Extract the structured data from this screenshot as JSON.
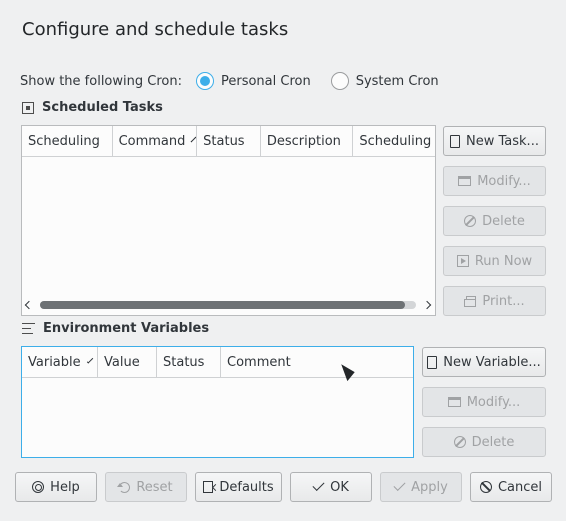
{
  "title": "Configure and schedule tasks",
  "cron_selector": {
    "label": "Show the following Cron:",
    "options": [
      {
        "label": "Personal Cron",
        "checked": true
      },
      {
        "label": "System Cron",
        "checked": false
      }
    ]
  },
  "scheduled_tasks": {
    "heading": "Scheduled Tasks",
    "columns": [
      "Scheduling",
      "Command",
      "Status",
      "Description",
      "Scheduling D"
    ],
    "buttons": {
      "new": "New Task...",
      "modify": "Modify...",
      "delete": "Delete",
      "run_now": "Run Now",
      "print": "Print..."
    },
    "scroll_position": 0.97
  },
  "environment_variables": {
    "heading": "Environment Variables",
    "columns": [
      "Variable",
      "Value",
      "Status",
      "Comment"
    ],
    "buttons": {
      "new": "New Variable...",
      "modify": "Modify...",
      "delete": "Delete"
    }
  },
  "footer": {
    "help": "Help",
    "reset": "Reset",
    "defaults": "Defaults",
    "ok": "OK",
    "apply": "Apply",
    "cancel": "Cancel"
  },
  "colors": {
    "accent": "#3daee9",
    "window_bg": "#eff0f1",
    "disabled_text": "#a0a2a4"
  }
}
